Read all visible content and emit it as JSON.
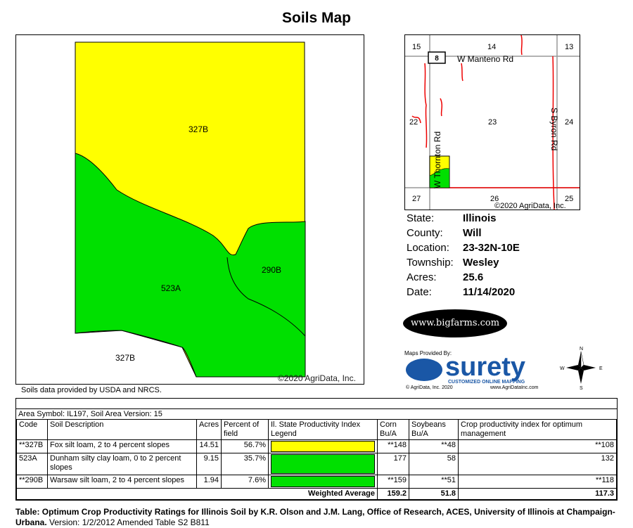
{
  "title": "Soils Map",
  "soil_map": {
    "labels": [
      "327B",
      "523A",
      "290B",
      "327B"
    ],
    "copyright": "©2020 AgriData, Inc.",
    "colors": {
      "yellow": "#ffff00",
      "green": "#00e000",
      "border": "#000000"
    }
  },
  "data_source": "Soils data provided by USDA and NRCS.",
  "location_map": {
    "roads": {
      "manteno": "W Manteno Rd",
      "thornton": "W Thornton Rd",
      "byron": "S Byron Rd"
    },
    "route_shield": "8",
    "sections": [
      "15",
      "14",
      "13",
      "22",
      "23",
      "24",
      "27",
      "26",
      "25"
    ],
    "copyright": "©2020 AgriData, Inc."
  },
  "info": {
    "state_label": "State:",
    "state": "Illinois",
    "county_label": "County:",
    "county": "Will",
    "location_label": "Location:",
    "location": "23-32N-10E",
    "township_label": "Township:",
    "township": "Wesley",
    "acres_label": "Acres:",
    "acres": "25.6",
    "date_label": "Date:",
    "date": "11/14/2020"
  },
  "bigfarms": "www.bigfarms.com",
  "surety": {
    "provided_by": "Maps Provided By:",
    "brand": "surety",
    "tagline": "CUSTOMIZED ONLINE MAPPING",
    "copyright": "© AgriData, Inc. 2020",
    "url": "www.AgriDataInc.com"
  },
  "compass": {
    "n": "N",
    "e": "E",
    "s": "S",
    "w": "W"
  },
  "table": {
    "area_symbol": "Area Symbol: IL197, Soil Area Version: 15",
    "headers": {
      "code": "Code",
      "description": "Soil Description",
      "acres": "Acres",
      "percent": "Percent of field",
      "legend": "Il. State Productivity Index Legend",
      "corn": "Corn Bu/A",
      "soybeans": "Soybeans Bu/A",
      "cpi": "Crop productivity index for optimum management"
    },
    "rows": [
      {
        "code": "**327B",
        "description": "Fox silt loam, 2 to 4 percent slopes",
        "acres": "14.51",
        "percent": "56.7%",
        "color": "#ffff00",
        "corn": "**148",
        "soybeans": "**48",
        "cpi": "**108"
      },
      {
        "code": "523A",
        "description": "Dunham silty clay loam, 0 to 2 percent slopes",
        "acres": "9.15",
        "percent": "35.7%",
        "color": "#00e000",
        "corn": "177",
        "soybeans": "58",
        "cpi": "132"
      },
      {
        "code": "**290B",
        "description": "Warsaw silt loam, 2 to 4 percent slopes",
        "acres": "1.94",
        "percent": "7.6%",
        "color": "#00e000",
        "corn": "**159",
        "soybeans": "**51",
        "cpi": "**118"
      }
    ],
    "weighted_label": "Weighted Average",
    "weighted_corn": "159.2",
    "weighted_soybeans": "51.8",
    "weighted_cpi": "117.3"
  },
  "footnote": {
    "bold": "Table: Optimum Crop Productivity Ratings for Illinois Soil by K.R. Olson and J.M. Lang, Office of Research, ACES, University of Illinois at Champaign-Urbana.",
    "rest": " Version: 1/2/2012 Amended Table S2 B811"
  }
}
